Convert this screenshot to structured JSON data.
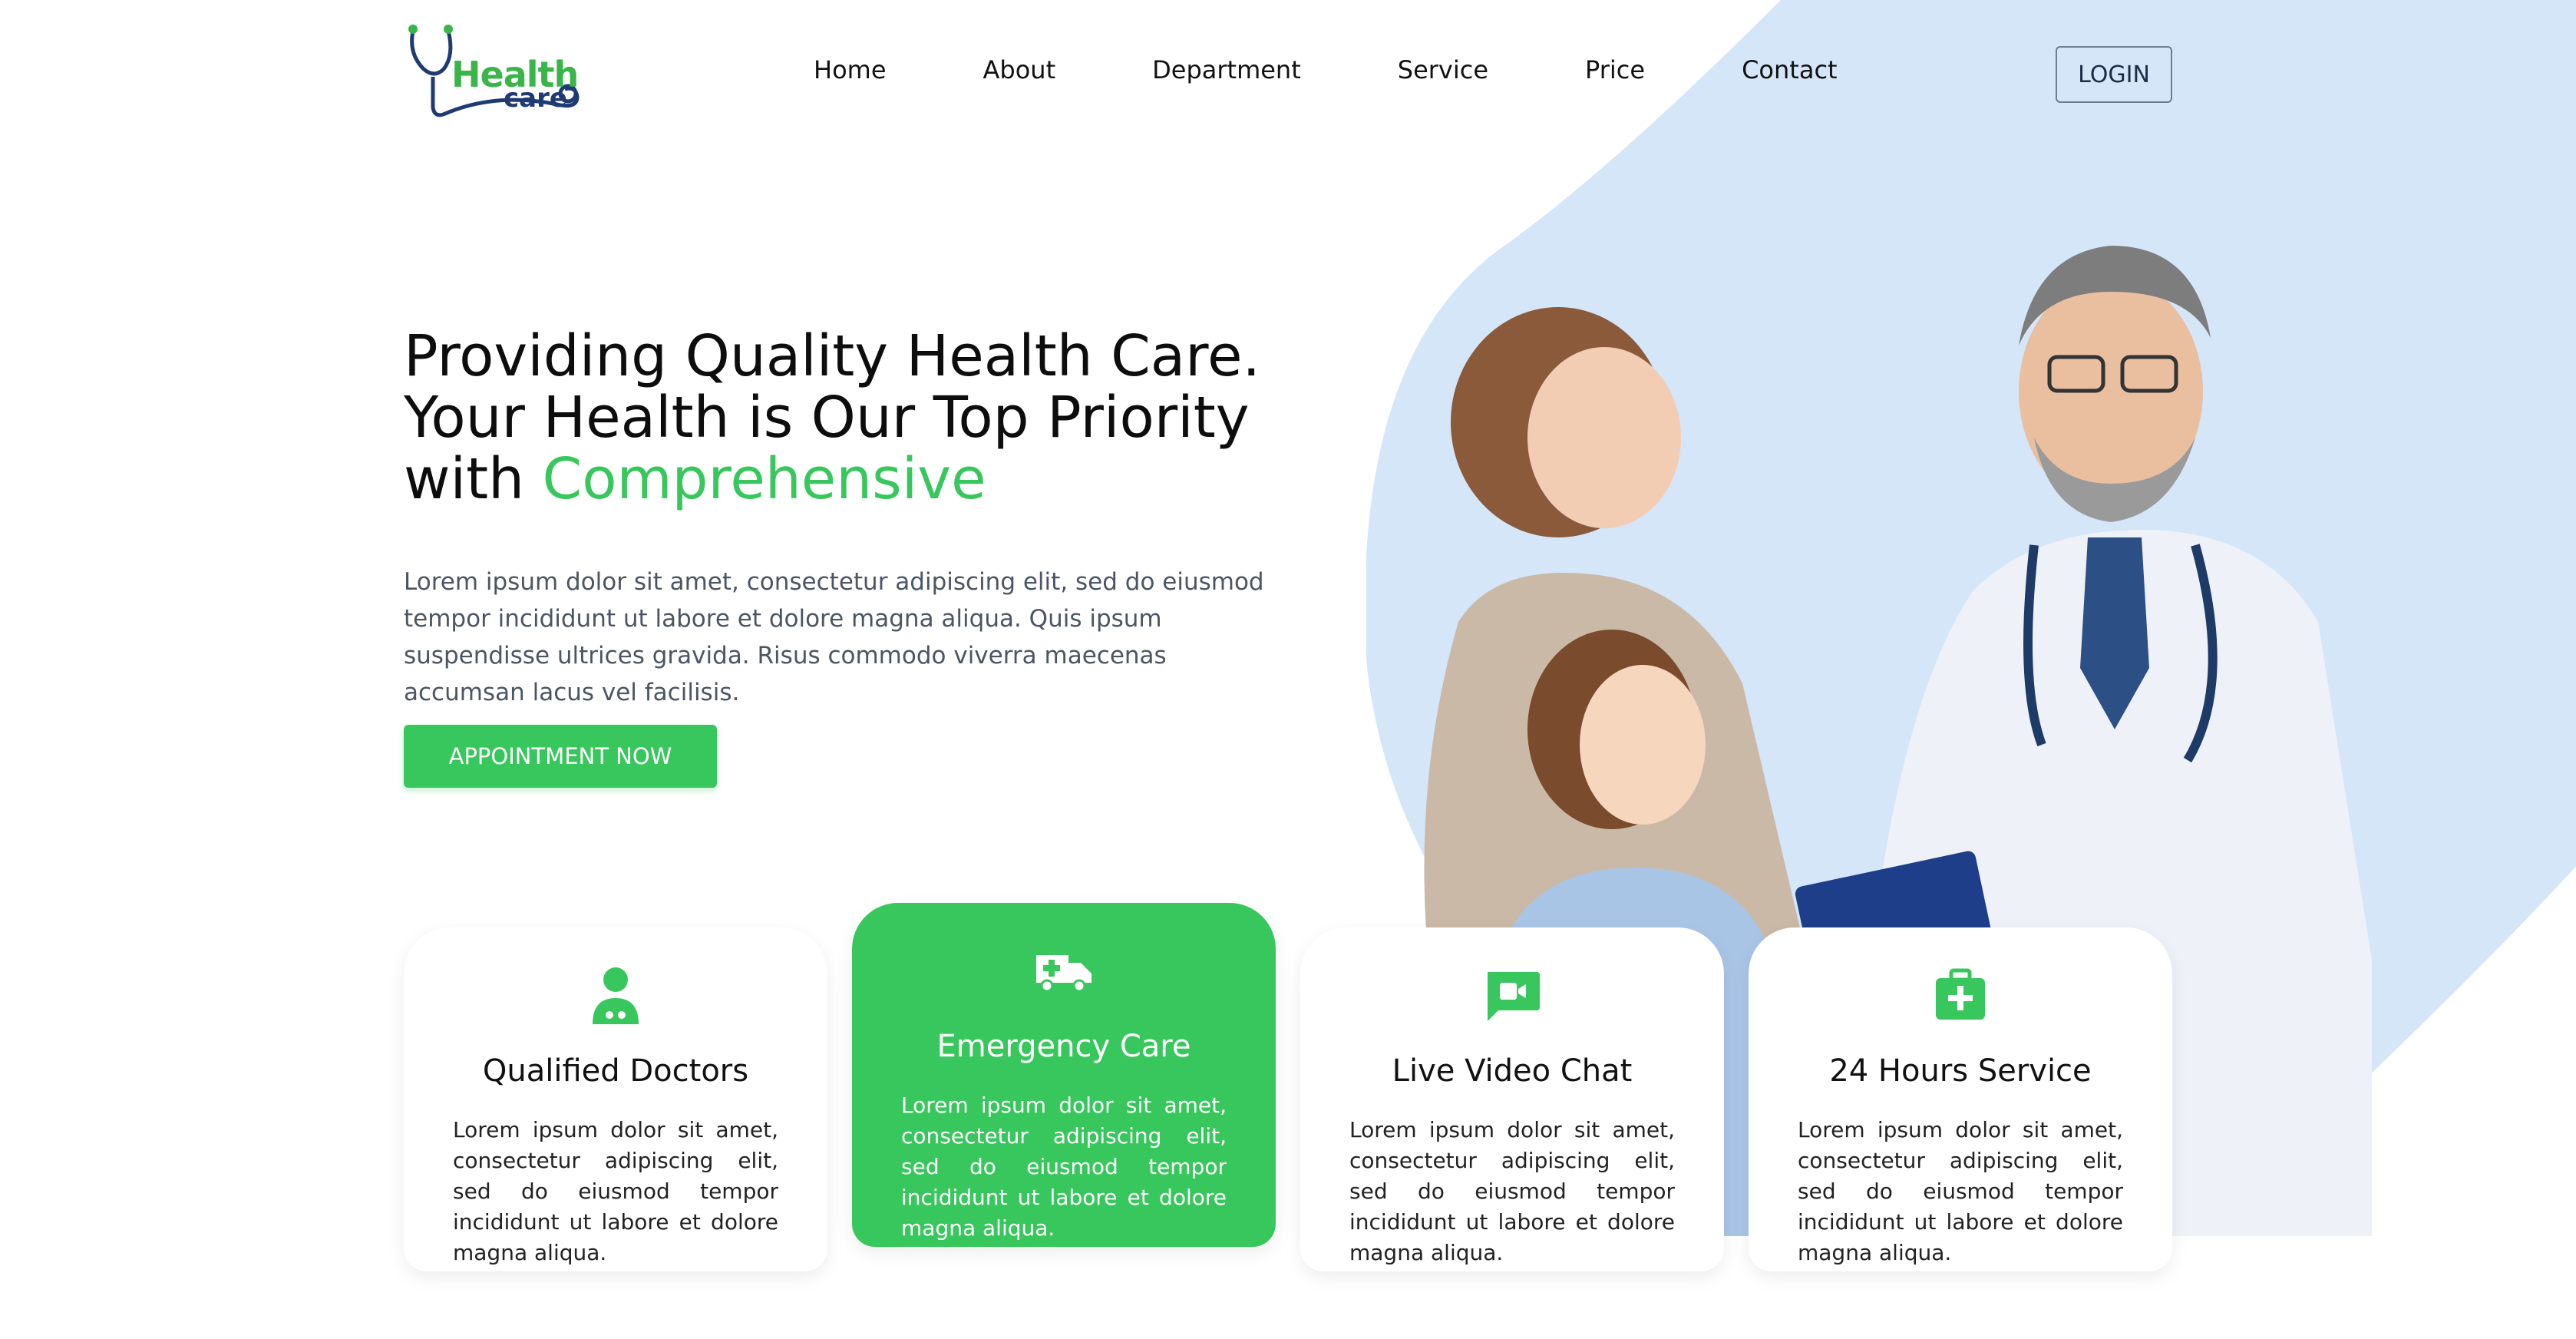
{
  "brand": {
    "logo_word_1": "Health",
    "logo_word_2": "care",
    "primary_color": "#38c75c",
    "secondary_color": "#1f3b73",
    "blob_color": "#d4e6f8"
  },
  "nav": {
    "items": [
      "Home",
      "About",
      "Department",
      "Service",
      "Price",
      "Contact"
    ],
    "login_label": "LOGIN"
  },
  "hero": {
    "title_line1": "Providing Quality Health Care.",
    "title_line2": "Your Health is Our Top Priority",
    "title_line3_prefix": "with ",
    "title_line3_accent": "Comprehensive",
    "description": "Lorem ipsum dolor sit amet, consectetur adipiscing elit, sed do eiusmod tempor incididunt ut labore et dolore magna aliqua. Quis ipsum suspendisse ultrices gravida. Risus commodo viverra maecenas accumsan lacus vel facilisis.",
    "cta_label": "APPOINTMENT NOW"
  },
  "features": [
    {
      "icon": "doctor-icon",
      "title": "Qualified Doctors",
      "text": "Lorem ipsum dolor sit amet, consectetur adipiscing elit, sed do eiusmod tempor incididunt ut labore et dolore magna aliqua.",
      "active": false
    },
    {
      "icon": "ambulance-icon",
      "title": "Emergency Care",
      "text": "Lorem ipsum dolor sit amet, consectetur adipiscing elit, sed do eiusmod tempor incididunt ut labore et dolore magna aliqua.",
      "active": true
    },
    {
      "icon": "video-chat-icon",
      "title": "Live Video Chat",
      "text": "Lorem ipsum dolor sit amet, consectetur adipiscing elit, sed do eiusmod tempor incididunt ut labore et dolore magna aliqua.",
      "active": false
    },
    {
      "icon": "first-aid-kit-icon",
      "title": "24 Hours Service",
      "text": "Lorem ipsum dolor sit amet, consectetur adipiscing elit, sed do eiusmod tempor incididunt ut labore et dolore magna aliqua.",
      "active": false
    }
  ]
}
